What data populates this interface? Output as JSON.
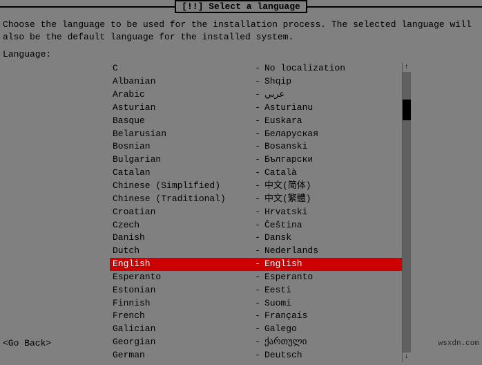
{
  "title": "[!!] Select a language",
  "description_line1": "Choose the language to be used for the installation process. The selected language will",
  "description_line2": "also be the default language for the installed system.",
  "language_label": "Language:",
  "go_back": "<Go Back>",
  "watermark": "wsxdn.com",
  "languages": [
    {
      "name": "C",
      "dash": "-",
      "native": "No localization"
    },
    {
      "name": "Albanian",
      "dash": "-",
      "native": "Shqip"
    },
    {
      "name": "Arabic",
      "dash": "-",
      "native": "عربي"
    },
    {
      "name": "Asturian",
      "dash": "-",
      "native": "Asturianu"
    },
    {
      "name": "Basque",
      "dash": "-",
      "native": "Euskara"
    },
    {
      "name": "Belarusian",
      "dash": "-",
      "native": "Беларуская"
    },
    {
      "name": "Bosnian",
      "dash": "-",
      "native": "Bosanski"
    },
    {
      "name": "Bulgarian",
      "dash": "-",
      "native": "Български"
    },
    {
      "name": "Catalan",
      "dash": "-",
      "native": "Català"
    },
    {
      "name": "Chinese (Simplified)",
      "dash": "-",
      "native": "中文(简体)"
    },
    {
      "name": "Chinese (Traditional)",
      "dash": "-",
      "native": "中文(繁體)"
    },
    {
      "name": "Croatian",
      "dash": "-",
      "native": "Hrvatski"
    },
    {
      "name": "Czech",
      "dash": "-",
      "native": "Čeština"
    },
    {
      "name": "Danish",
      "dash": "-",
      "native": "Dansk"
    },
    {
      "name": "Dutch",
      "dash": "-",
      "native": "Nederlands"
    },
    {
      "name": "English",
      "dash": "-",
      "native": "English",
      "selected": true
    },
    {
      "name": "Esperanto",
      "dash": "-",
      "native": "Esperanto"
    },
    {
      "name": "Estonian",
      "dash": "-",
      "native": "Eesti"
    },
    {
      "name": "Finnish",
      "dash": "-",
      "native": "Suomi"
    },
    {
      "name": "French",
      "dash": "-",
      "native": "Français"
    },
    {
      "name": "Galician",
      "dash": "-",
      "native": "Galego"
    },
    {
      "name": "Georgian",
      "dash": "-",
      "native": "ქართული"
    },
    {
      "name": "German",
      "dash": "-",
      "native": "Deutsch"
    }
  ],
  "scroll": {
    "up_arrow": "↑",
    "down_arrow": "↓"
  }
}
